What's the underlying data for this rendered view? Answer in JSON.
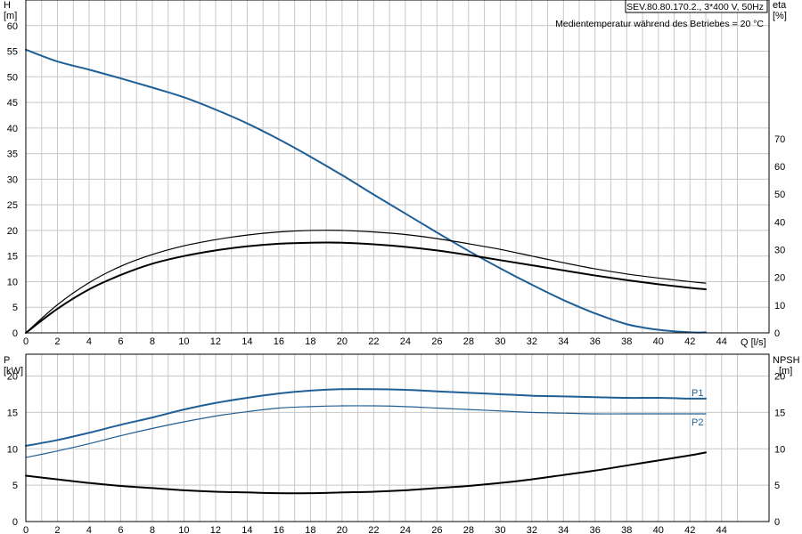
{
  "info": {
    "model": "SEV.80.80.170.2., 3*400 V, 50Hz",
    "note": "Medientemperatur während des Betriebes = 20 °C"
  },
  "colors": {
    "blue": "#1f5f96",
    "black": "#000000",
    "grid": "#c8c8c8"
  },
  "chart_data": [
    {
      "type": "line",
      "id": "top",
      "y_left_label": [
        "H",
        "[m]"
      ],
      "y_right_label": [
        "eta",
        "[%]"
      ],
      "x_label": "Q [l/s]",
      "xlim": [
        0,
        47
      ],
      "ylim": [
        0,
        65
      ],
      "y_right_lim": [
        0,
        120
      ],
      "x_ticks": [
        0,
        2,
        4,
        6,
        8,
        10,
        12,
        14,
        16,
        18,
        20,
        22,
        24,
        26,
        28,
        30,
        32,
        34,
        36,
        38,
        40,
        42,
        44
      ],
      "y_ticks": [
        0,
        5,
        10,
        15,
        20,
        25,
        30,
        35,
        40,
        45,
        50,
        55,
        60
      ],
      "y_right_ticks": [
        0,
        10,
        20,
        30,
        40,
        50,
        60,
        70
      ],
      "grid": true,
      "series": [
        {
          "name": "H",
          "axis": "left",
          "color": "#1f5f96",
          "width": 2,
          "x": [
            0,
            2,
            4,
            6,
            8,
            10,
            12,
            14,
            16,
            18,
            20,
            22,
            24,
            26,
            28,
            30,
            32,
            34,
            36,
            38,
            40,
            42,
            43
          ],
          "y": [
            55.3,
            53.0,
            51.4,
            49.7,
            47.9,
            46.0,
            43.6,
            40.9,
            37.8,
            34.4,
            30.8,
            27.0,
            23.3,
            19.6,
            16.0,
            12.6,
            9.4,
            6.4,
            3.8,
            1.7,
            0.6,
            0.1,
            0.1
          ]
        },
        {
          "name": "eta1",
          "axis": "left",
          "color": "#000000",
          "width": 1.2,
          "x": [
            0,
            2,
            4,
            6,
            8,
            10,
            12,
            14,
            16,
            18,
            20,
            22,
            24,
            26,
            28,
            30,
            32,
            34,
            36,
            38,
            40,
            42,
            43
          ],
          "y": [
            0,
            5.5,
            9.8,
            13.0,
            15.3,
            17.0,
            18.2,
            19.1,
            19.7,
            20.0,
            20.0,
            19.7,
            19.2,
            18.4,
            17.4,
            16.3,
            15.0,
            13.7,
            12.5,
            11.5,
            10.7,
            10.0,
            9.7
          ]
        },
        {
          "name": "eta2",
          "axis": "left",
          "color": "#000000",
          "width": 2,
          "x": [
            0,
            2,
            4,
            6,
            8,
            10,
            12,
            14,
            16,
            18,
            20,
            22,
            24,
            26,
            28,
            30,
            32,
            34,
            36,
            38,
            40,
            42,
            43
          ],
          "y": [
            0,
            4.7,
            8.5,
            11.3,
            13.5,
            15.0,
            16.1,
            16.9,
            17.4,
            17.6,
            17.6,
            17.3,
            16.8,
            16.1,
            15.2,
            14.2,
            13.2,
            12.2,
            11.2,
            10.3,
            9.5,
            8.8,
            8.5
          ]
        }
      ]
    },
    {
      "type": "line",
      "id": "bottom",
      "y_left_label": [
        "P",
        "[kW]"
      ],
      "y_right_label": [
        "NPSH",
        "[m]"
      ],
      "xlim": [
        0,
        47
      ],
      "ylim": [
        0,
        23
      ],
      "x_ticks": [
        0,
        2,
        4,
        6,
        8,
        10,
        12,
        14,
        16,
        18,
        20,
        22,
        24,
        26,
        28,
        30,
        32,
        34,
        36,
        38,
        40,
        42,
        44
      ],
      "y_ticks": [
        0,
        5,
        10,
        15,
        20
      ],
      "y_right_ticks": [
        0,
        5,
        10,
        15,
        20
      ],
      "grid": true,
      "series": [
        {
          "name": "P1",
          "axis": "left",
          "color": "#1f5f96",
          "width": 2,
          "x": [
            0,
            2,
            4,
            6,
            8,
            10,
            12,
            14,
            16,
            18,
            20,
            22,
            24,
            26,
            28,
            30,
            32,
            34,
            36,
            38,
            40,
            42,
            43
          ],
          "y": [
            10.4,
            11.2,
            12.2,
            13.3,
            14.3,
            15.4,
            16.3,
            17.0,
            17.6,
            18.0,
            18.2,
            18.2,
            18.1,
            17.9,
            17.7,
            17.5,
            17.3,
            17.2,
            17.1,
            17.0,
            17.0,
            16.9,
            16.9
          ]
        },
        {
          "name": "P2",
          "axis": "left",
          "color": "#1f5f96",
          "width": 1.2,
          "x": [
            0,
            2,
            4,
            6,
            8,
            10,
            12,
            14,
            16,
            18,
            20,
            22,
            24,
            26,
            28,
            30,
            32,
            34,
            36,
            38,
            40,
            42,
            43
          ],
          "y": [
            8.8,
            9.7,
            10.7,
            11.8,
            12.8,
            13.7,
            14.5,
            15.1,
            15.6,
            15.8,
            15.9,
            15.9,
            15.8,
            15.6,
            15.4,
            15.2,
            15.0,
            14.9,
            14.8,
            14.8,
            14.8,
            14.8,
            14.8
          ]
        },
        {
          "name": "NPSH",
          "axis": "left",
          "color": "#000000",
          "width": 2,
          "x": [
            0,
            2,
            4,
            6,
            8,
            10,
            12,
            14,
            16,
            18,
            20,
            22,
            24,
            26,
            28,
            30,
            32,
            34,
            36,
            38,
            40,
            42,
            43
          ],
          "y": [
            6.3,
            5.8,
            5.3,
            4.9,
            4.6,
            4.3,
            4.1,
            4.0,
            3.9,
            3.9,
            4.0,
            4.1,
            4.3,
            4.6,
            4.9,
            5.3,
            5.8,
            6.4,
            7.0,
            7.7,
            8.4,
            9.1,
            9.5
          ]
        }
      ],
      "labels": [
        {
          "text": "P1",
          "series": "P1"
        },
        {
          "text": "P2",
          "series": "P2"
        }
      ]
    }
  ]
}
